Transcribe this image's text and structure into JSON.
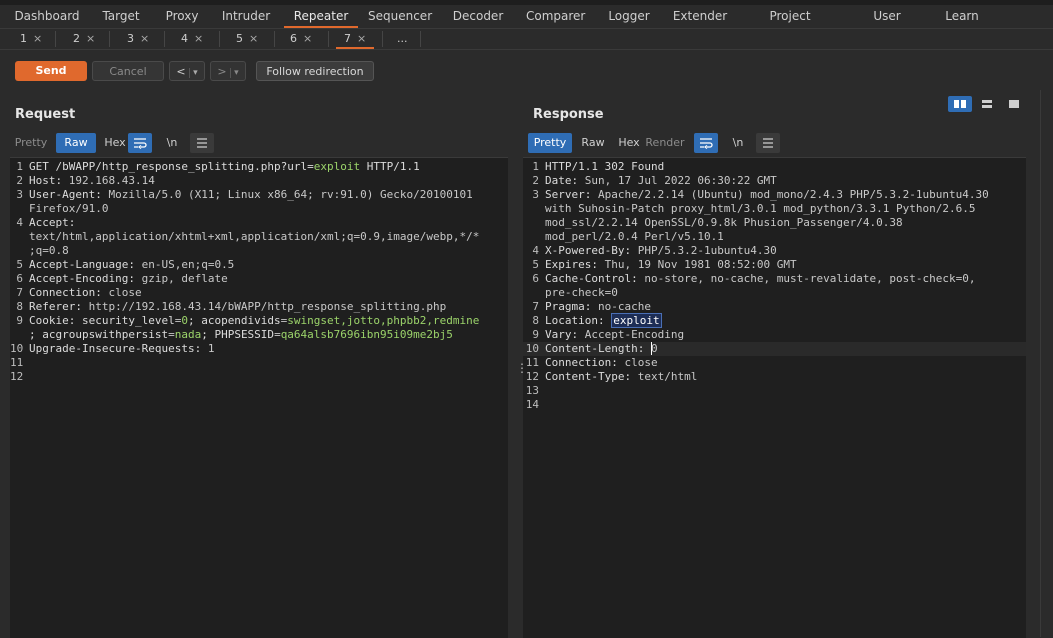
{
  "main_tabs": [
    "Dashboard",
    "Target",
    "Proxy",
    "Intruder",
    "Repeater",
    "Sequencer",
    "Decoder",
    "Comparer",
    "Logger",
    "Extender",
    "Project options",
    "User options",
    "Learn"
  ],
  "sub_tabs": [
    {
      "label": "1",
      "close": "×"
    },
    {
      "label": "2",
      "close": "×"
    },
    {
      "label": "3",
      "close": "×"
    },
    {
      "label": "4",
      "close": "×"
    },
    {
      "label": "5",
      "close": "×"
    },
    {
      "label": "6",
      "close": "×"
    },
    {
      "label": "7",
      "close": "×"
    },
    {
      "label": "...",
      "close": ""
    }
  ],
  "toolbar": {
    "send": "Send",
    "cancel": "Cancel",
    "back": "<",
    "forward": ">",
    "dropdown": "▾",
    "follow": "Follow redirection"
  },
  "request": {
    "title": "Request",
    "tabs": [
      "Pretty",
      "Raw",
      "Hex"
    ],
    "wrap_icon": "wrap-icon",
    "newline_label": "\\n",
    "menu_icon": "menu-icon",
    "lines": [
      {
        "n": "1",
        "parts": [
          {
            "t": "GET /bWAPP/http_response_splitting.php?url=",
            "c": "hdr"
          },
          {
            "t": "exploit",
            "c": "green"
          },
          {
            "t": " HTTP/1.1",
            "c": "hdr"
          }
        ]
      },
      {
        "n": "2",
        "parts": [
          {
            "t": "Host: ",
            "c": "hdr"
          },
          {
            "t": "192.168.43.14",
            "c": "val"
          }
        ]
      },
      {
        "n": "3",
        "parts": [
          {
            "t": "User-Agent: ",
            "c": "hdr"
          },
          {
            "t": "Mozilla/5.0 (X11; Linux x86_64; rv:91.0) Gecko/20100101",
            "c": "val"
          }
        ]
      },
      {
        "n": "",
        "parts": [
          {
            "t": "Firefox/91.0",
            "c": "val"
          }
        ]
      },
      {
        "n": "4",
        "parts": [
          {
            "t": "Accept:",
            "c": "hdr"
          }
        ]
      },
      {
        "n": "",
        "parts": [
          {
            "t": "text/html,application/xhtml+xml,application/xml;q=0.9,image/webp,*/*",
            "c": "val"
          }
        ]
      },
      {
        "n": "",
        "parts": [
          {
            "t": ";q=0.8",
            "c": "val"
          }
        ]
      },
      {
        "n": "5",
        "parts": [
          {
            "t": "Accept-Language: ",
            "c": "hdr"
          },
          {
            "t": "en-US,en;q=0.5",
            "c": "val"
          }
        ]
      },
      {
        "n": "6",
        "parts": [
          {
            "t": "Accept-Encoding: ",
            "c": "hdr"
          },
          {
            "t": "gzip, deflate",
            "c": "val"
          }
        ]
      },
      {
        "n": "7",
        "parts": [
          {
            "t": "Connection: ",
            "c": "hdr"
          },
          {
            "t": "close",
            "c": "val"
          }
        ]
      },
      {
        "n": "8",
        "parts": [
          {
            "t": "Referer: ",
            "c": "hdr"
          },
          {
            "t": "http://192.168.43.14/bWAPP/http_response_splitting.php",
            "c": "val"
          }
        ]
      },
      {
        "n": "9",
        "parts": [
          {
            "t": "Cookie: ",
            "c": "hdr"
          },
          {
            "t": "security_level",
            "c": "hdr"
          },
          {
            "t": "=",
            "c": "val"
          },
          {
            "t": "0",
            "c": "green"
          },
          {
            "t": "; acopendivids",
            "c": "hdr"
          },
          {
            "t": "=",
            "c": "val"
          },
          {
            "t": "swingset,jotto,phpbb2,redmine",
            "c": "green"
          }
        ]
      },
      {
        "n": "",
        "parts": [
          {
            "t": "; acgroupswithpersist",
            "c": "hdr"
          },
          {
            "t": "=",
            "c": "val"
          },
          {
            "t": "nada",
            "c": "green"
          },
          {
            "t": "; PHPSESSID",
            "c": "hdr"
          },
          {
            "t": "=",
            "c": "val"
          },
          {
            "t": "qa64alsb7696ibn95i09me2bj5",
            "c": "green"
          }
        ]
      },
      {
        "n": "10",
        "parts": [
          {
            "t": "Upgrade-Insecure-Requests: ",
            "c": "hdr"
          },
          {
            "t": "1",
            "c": "val"
          }
        ]
      },
      {
        "n": "11",
        "parts": []
      },
      {
        "n": "12",
        "parts": []
      }
    ]
  },
  "response": {
    "title": "Response",
    "tabs": [
      "Pretty",
      "Raw",
      "Hex",
      "Render"
    ],
    "newline_label": "\\n",
    "lines": [
      {
        "n": "1",
        "parts": [
          {
            "t": "HTTP/1.1 302 Found",
            "c": "hdr"
          }
        ]
      },
      {
        "n": "2",
        "parts": [
          {
            "t": "Date: ",
            "c": "hdr"
          },
          {
            "t": "Sun, 17 Jul 2022 06:30:22 GMT",
            "c": "val"
          }
        ]
      },
      {
        "n": "3",
        "parts": [
          {
            "t": "Server: ",
            "c": "hdr"
          },
          {
            "t": "Apache/2.2.14 (Ubuntu) mod_mono/2.4.3 PHP/5.3.2-1ubuntu4.30",
            "c": "val"
          }
        ]
      },
      {
        "n": "",
        "parts": [
          {
            "t": "with Suhosin-Patch proxy_html/3.0.1 mod_python/3.3.1 Python/2.6.5",
            "c": "val"
          }
        ]
      },
      {
        "n": "",
        "parts": [
          {
            "t": "mod_ssl/2.2.14 OpenSSL/0.9.8k Phusion_Passenger/4.0.38",
            "c": "val"
          }
        ]
      },
      {
        "n": "",
        "parts": [
          {
            "t": "mod_perl/2.0.4 Perl/v5.10.1",
            "c": "val"
          }
        ]
      },
      {
        "n": "4",
        "parts": [
          {
            "t": "X-Powered-By: ",
            "c": "hdr"
          },
          {
            "t": "PHP/5.3.2-1ubuntu4.30",
            "c": "val"
          }
        ]
      },
      {
        "n": "5",
        "parts": [
          {
            "t": "Expires: ",
            "c": "hdr"
          },
          {
            "t": "Thu, 19 Nov 1981 08:52:00 GMT",
            "c": "val"
          }
        ]
      },
      {
        "n": "6",
        "parts": [
          {
            "t": "Cache-Control: ",
            "c": "hdr"
          },
          {
            "t": "no-store, no-cache, must-revalidate, post-check=0,",
            "c": "val"
          }
        ]
      },
      {
        "n": "",
        "parts": [
          {
            "t": "pre-check=0",
            "c": "val"
          }
        ]
      },
      {
        "n": "7",
        "parts": [
          {
            "t": "Pragma: ",
            "c": "hdr"
          },
          {
            "t": "no-cache",
            "c": "val"
          }
        ]
      },
      {
        "n": "8",
        "parts": [
          {
            "t": "Location: ",
            "c": "hdr"
          },
          {
            "t": "exploit",
            "c": "boxed"
          }
        ]
      },
      {
        "n": "9",
        "parts": [
          {
            "t": "Vary: ",
            "c": "hdr"
          },
          {
            "t": "Accept-Encoding",
            "c": "val"
          }
        ]
      },
      {
        "n": "10",
        "parts": [
          {
            "t": "Content-Length: ",
            "c": "hdr"
          },
          {
            "t": "0",
            "c": "val"
          }
        ],
        "highlight": true
      },
      {
        "n": "11",
        "parts": [
          {
            "t": "Connection: ",
            "c": "hdr"
          },
          {
            "t": "close",
            "c": "val"
          }
        ]
      },
      {
        "n": "12",
        "parts": [
          {
            "t": "Content-Type: ",
            "c": "hdr"
          },
          {
            "t": "text/html",
            "c": "val"
          }
        ]
      },
      {
        "n": "13",
        "parts": []
      },
      {
        "n": "14",
        "parts": []
      }
    ]
  }
}
